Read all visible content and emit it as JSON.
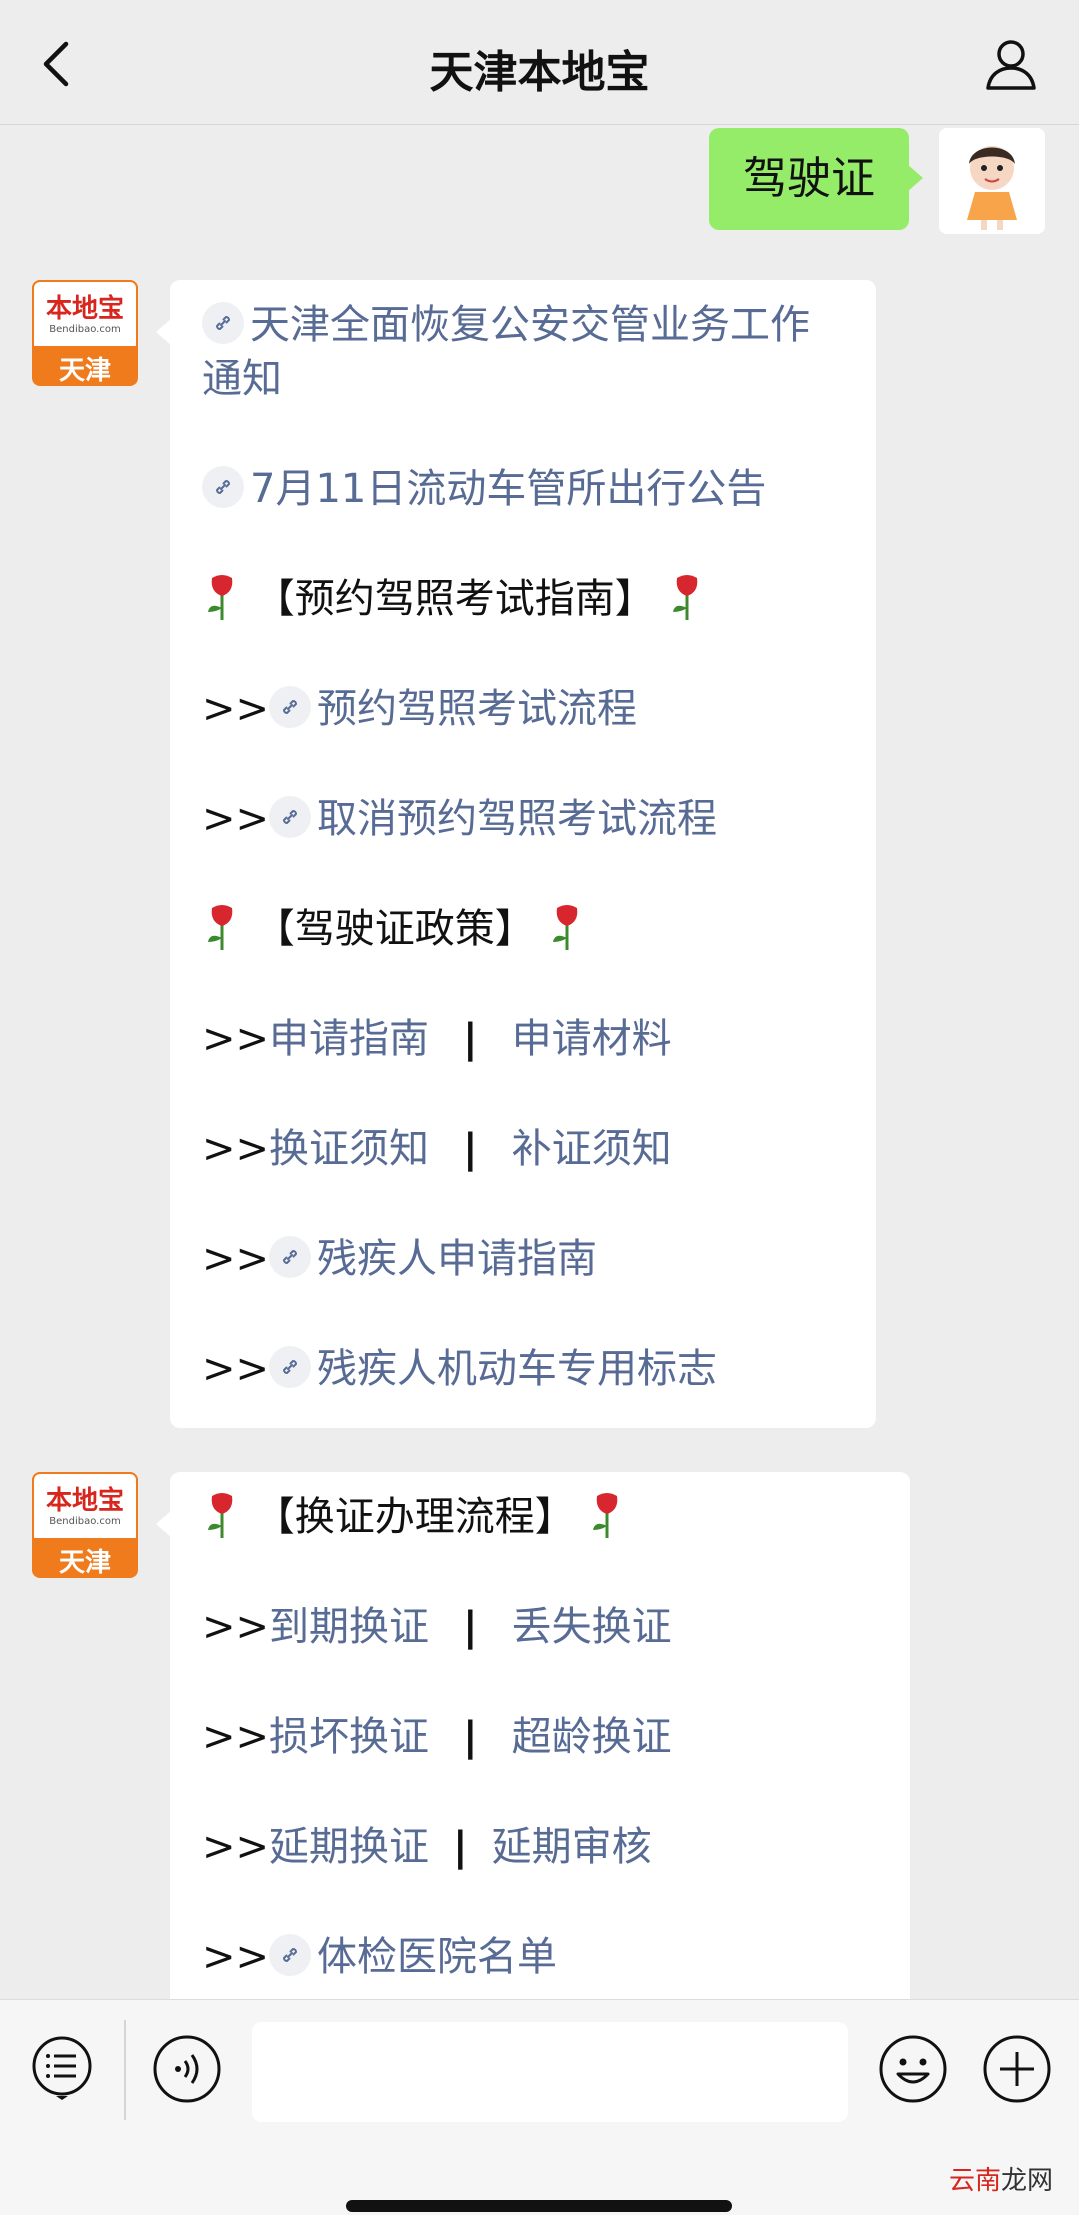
{
  "header": {
    "title": "天津本地宝"
  },
  "my_message": {
    "text": "驾驶证"
  },
  "bot": {
    "avatar_logo": "本地宝",
    "avatar_sub": "Bendibao.com",
    "avatar_city": "天津"
  },
  "message1": {
    "link1": "天津全面恢复公安交管业务工作通知",
    "link2": "7月11日流动车管所出行公告",
    "heading1": "【预约驾照考试指南】",
    "prefix": ">>",
    "link3": "预约驾照考试流程",
    "link4": "取消预约驾照考试流程",
    "heading2": "【驾驶证政策】",
    "link5a": "申请指南",
    "link5b": "申请材料",
    "link6a": "换证须知",
    "link6b": "补证须知",
    "link7": "残疾人申请指南",
    "link8": "残疾人机动车专用标志",
    "separator": "|"
  },
  "message2": {
    "heading": "【换证办理流程】",
    "link1a": "到期换证",
    "link1b": "丢失换证",
    "link2a": "损坏换证",
    "link2b": "超龄换证",
    "link3a": "延期换证",
    "link3b": "延期审核",
    "link4": "体检医院名单"
  },
  "watermark": {
    "part1": "云南",
    "part2": "龙网"
  },
  "icons": [
    "back-arrow-icon",
    "profile-icon",
    "link-icon",
    "flower-icon",
    "menu-list-icon",
    "voice-icon",
    "emoji-icon",
    "plus-icon"
  ],
  "colors": {
    "link": "#576b95",
    "my_bubble": "#95ec69",
    "background": "#ededed"
  }
}
